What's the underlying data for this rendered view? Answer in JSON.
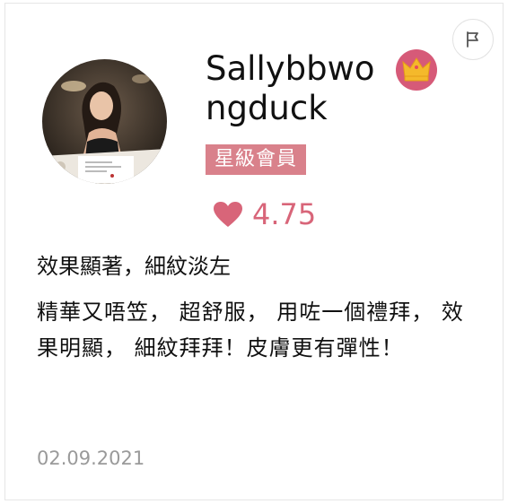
{
  "user": {
    "name": "Sallybbwongduck",
    "badge": "星級會員"
  },
  "rating": {
    "value": "4.75"
  },
  "review": {
    "title": "效果顯著，細紋淡左",
    "body": "精華又唔笠， 超舒服， 用咗一個禮拜， 效果明顯， 細紋拜拜！皮膚更有彈性！",
    "date": "02.09.2021"
  },
  "icons": {
    "flag": "flag-icon",
    "crown": "crown-icon",
    "heart": "heart-icon"
  },
  "colors": {
    "accent": "#d86579",
    "badge_bg": "#d9818b",
    "crown_bg": "#d65a78",
    "crown_gold": "#f4b92b",
    "date_text": "#9a9a9a"
  }
}
